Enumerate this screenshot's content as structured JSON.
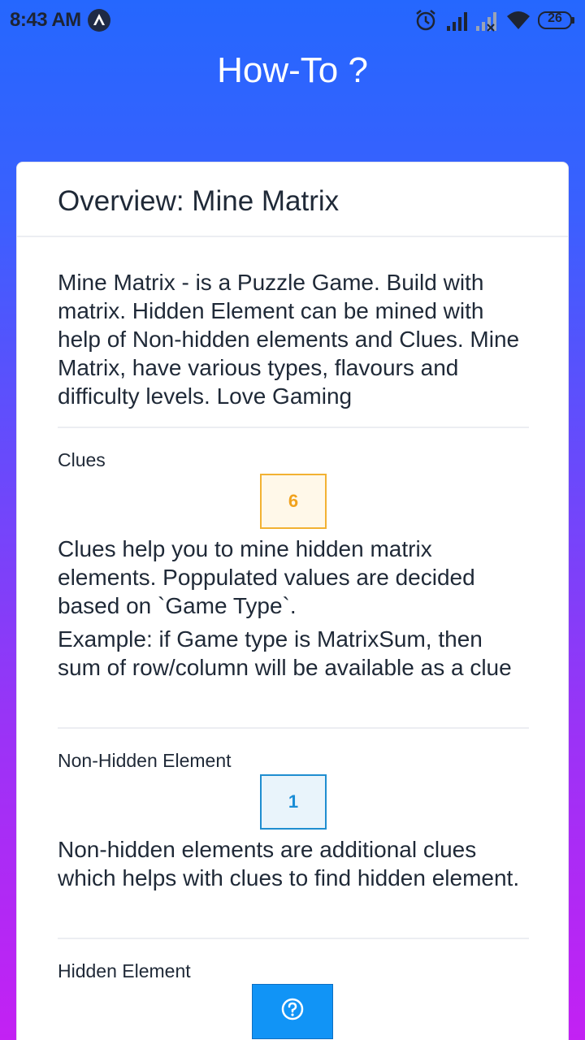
{
  "status_bar": {
    "time": "8:43 AM",
    "battery": "26",
    "icons": [
      "app-notification-icon",
      "alarm-icon",
      "signal-icon",
      "signal-x-icon",
      "wifi-icon",
      "battery-icon"
    ]
  },
  "app_bar": {
    "title": "How-To ?"
  },
  "card": {
    "title": "Overview: Mine Matrix",
    "intro": "Mine Matrix - is a Puzzle Game. Build with matrix. Hidden Element can be mined with help of Non-hidden elements and Clues. Mine Matrix, have various types, flavours and difficulty levels. Love Gaming",
    "sections": [
      {
        "title": "Clues",
        "cell_value": "6",
        "text": "Clues help you to mine hidden matrix elements. Poppulated values are decided based on `Game Type`.",
        "text2": "Example: if Game type is MatrixSum, then sum of row/column will be available as a clue"
      },
      {
        "title": "Non-Hidden Element",
        "cell_value": "1",
        "text": "Non-hidden elements are additional clues which helps with clues to find hidden element."
      },
      {
        "title": "Hidden Element",
        "cell_icon": "question-circle-icon"
      }
    ]
  },
  "colors": {
    "gradient_top": "#2567fe",
    "gradient_bottom": "#c321f3",
    "clue_border": "#f2b233",
    "non_hidden_border": "#1f8ed0",
    "hidden_fill": "#1194f6"
  }
}
